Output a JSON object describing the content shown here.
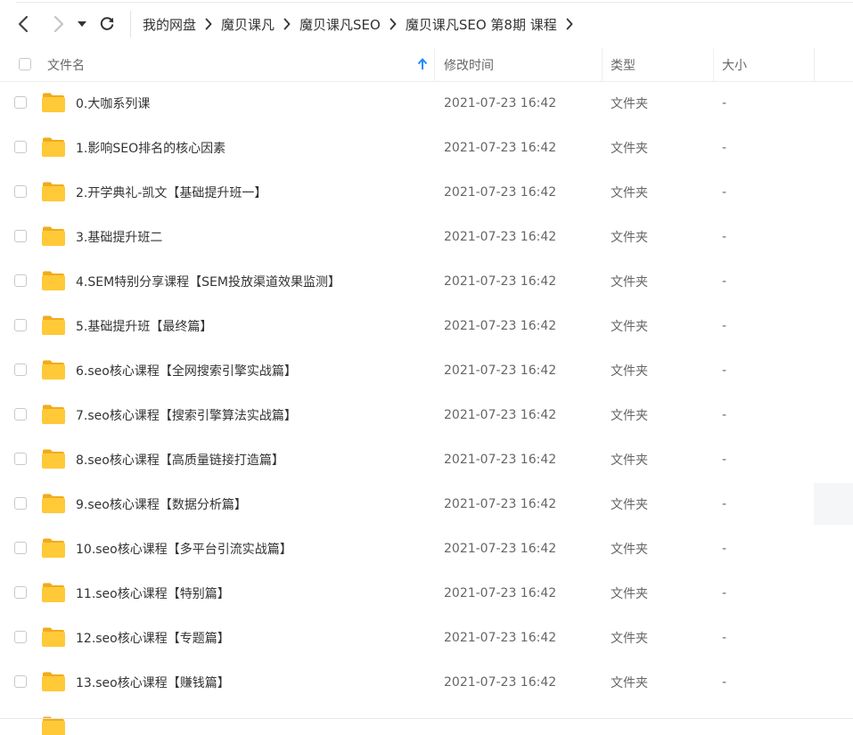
{
  "toolbar": {
    "back_icon": "chevron-left",
    "forward_icon": "chevron-right",
    "history_icon": "caret-down",
    "refresh_icon": "refresh"
  },
  "breadcrumb": [
    {
      "label": "我的网盘"
    },
    {
      "label": "魔贝课凡"
    },
    {
      "label": "魔贝课凡SEO"
    },
    {
      "label": "魔贝课凡SEO 第8期 课程"
    }
  ],
  "columns": {
    "name": "文件名",
    "modified": "修改时间",
    "type": "类型",
    "size": "大小",
    "sort_icon": "arrow-up",
    "accent_color": "#1a8cff"
  },
  "files": [
    {
      "name": "0.大咖系列课",
      "modified": "2021-07-23 16:42",
      "type": "文件夹",
      "size": "-"
    },
    {
      "name": "1.影响SEO排名的核心因素",
      "modified": "2021-07-23 16:42",
      "type": "文件夹",
      "size": "-"
    },
    {
      "name": "2.开学典礼-凯文【基础提升班一】",
      "modified": "2021-07-23 16:42",
      "type": "文件夹",
      "size": "-"
    },
    {
      "name": "3.基础提升班二",
      "modified": "2021-07-23 16:42",
      "type": "文件夹",
      "size": "-"
    },
    {
      "name": "4.SEM特别分享课程【SEM投放渠道效果监测】",
      "modified": "2021-07-23 16:42",
      "type": "文件夹",
      "size": "-"
    },
    {
      "name": "5.基础提升班【最终篇】",
      "modified": "2021-07-23 16:42",
      "type": "文件夹",
      "size": "-"
    },
    {
      "name": "6.seo核心课程【全网搜索引擎实战篇】",
      "modified": "2021-07-23 16:42",
      "type": "文件夹",
      "size": "-"
    },
    {
      "name": "7.seo核心课程【搜索引擎算法实战篇】",
      "modified": "2021-07-23 16:42",
      "type": "文件夹",
      "size": "-"
    },
    {
      "name": "8.seo核心课程【高质量链接打造篇】",
      "modified": "2021-07-23 16:42",
      "type": "文件夹",
      "size": "-"
    },
    {
      "name": "9.seo核心课程【数据分析篇】",
      "modified": "2021-07-23 16:42",
      "type": "文件夹",
      "size": "-"
    },
    {
      "name": "10.seo核心课程【多平台引流实战篇】",
      "modified": "2021-07-23 16:42",
      "type": "文件夹",
      "size": "-"
    },
    {
      "name": "11.seo核心课程【特别篇】",
      "modified": "2021-07-23 16:42",
      "type": "文件夹",
      "size": "-"
    },
    {
      "name": "12.seo核心课程【专题篇】",
      "modified": "2021-07-23 16:42",
      "type": "文件夹",
      "size": "-"
    },
    {
      "name": "13.seo核心课程【赚钱篇】",
      "modified": "2021-07-23 16:42",
      "type": "文件夹",
      "size": "-"
    }
  ],
  "folder_icon": "folder-icon",
  "folder_color": "#ffc938"
}
